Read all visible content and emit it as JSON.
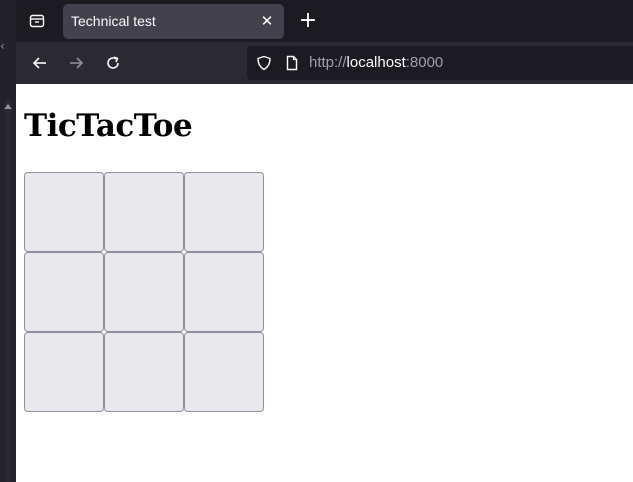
{
  "browser": {
    "tab": {
      "title": "Technical test",
      "close_glyph": "✕"
    },
    "new_tab_glyph": "+",
    "url": {
      "scheme": "http://",
      "host": "localhost",
      "port": ":8000"
    },
    "icons": [
      "tab-list-icon",
      "back-arrow-icon",
      "forward-arrow-icon",
      "reload-icon",
      "shield-icon",
      "page-icon",
      "close-icon",
      "plus-icon"
    ]
  },
  "page": {
    "title": "TicTacToe",
    "board": {
      "rows": 3,
      "cols": 3,
      "cells": [
        "",
        "",
        "",
        "",
        "",
        "",
        "",
        "",
        ""
      ]
    }
  },
  "colors": {
    "tab_active": "#42414d",
    "toolbar": "#2b2a33",
    "tabstrip": "#1c1b22",
    "cell_bg": "#e9e9ed",
    "cell_border": "#8f8f9d"
  }
}
